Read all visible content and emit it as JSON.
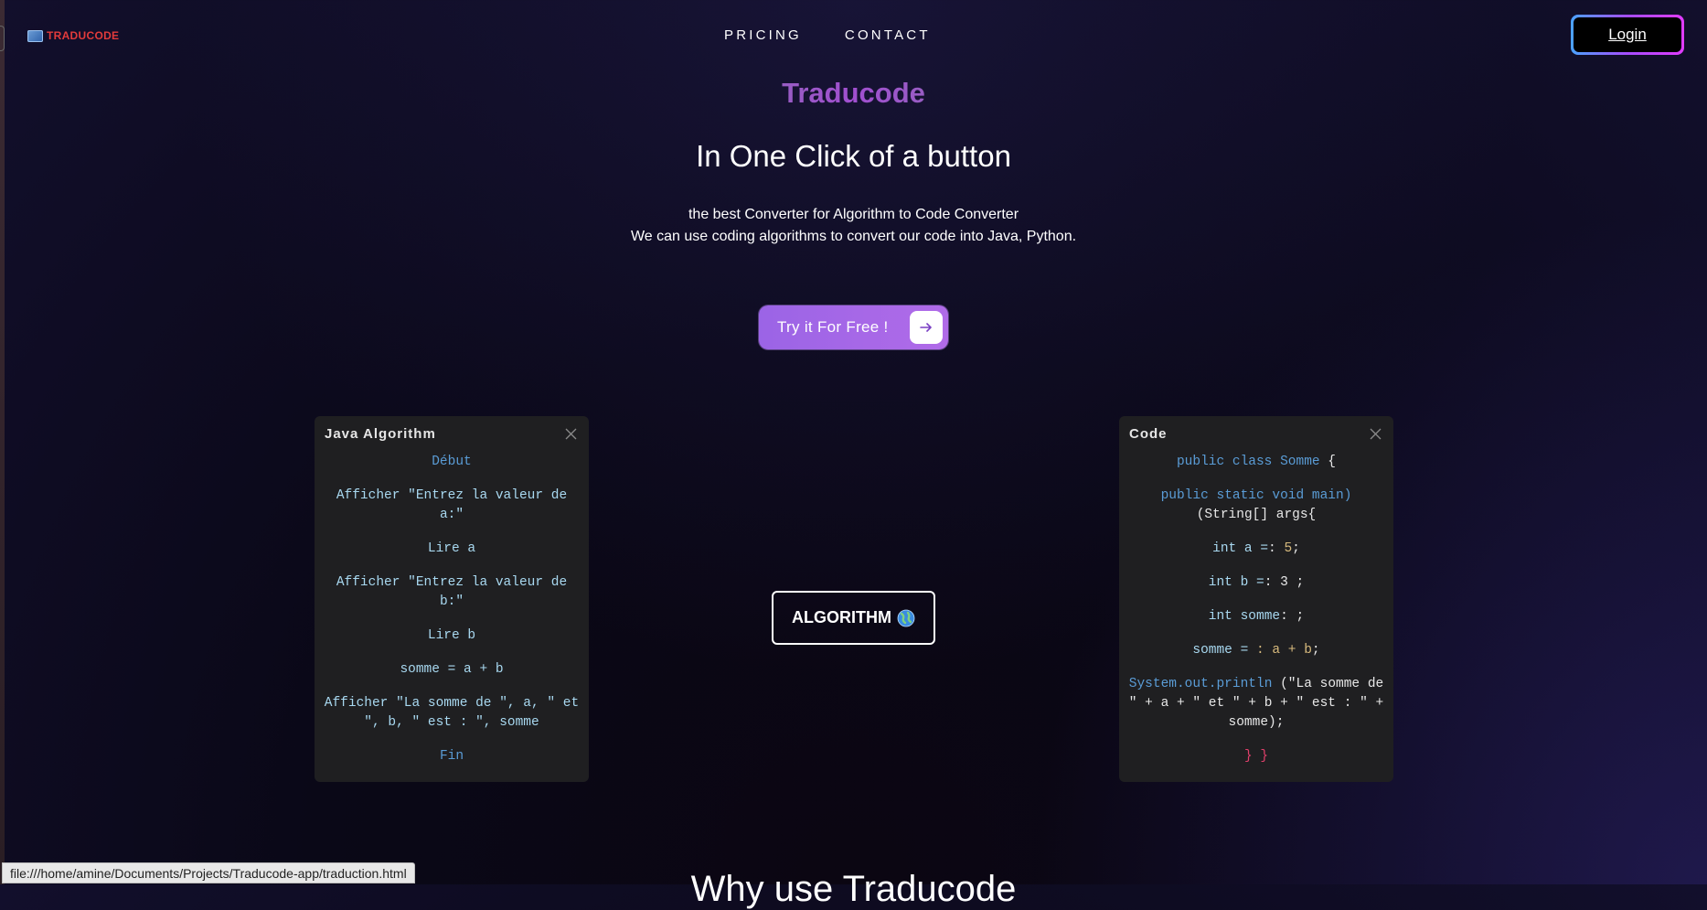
{
  "header": {
    "logo_text": "TRADUCODE",
    "nav": [
      "PRICING",
      "CONTACT"
    ],
    "login_label": "Login"
  },
  "hero": {
    "title": "Traducode",
    "subtitle": "In One Click of a button",
    "desc_line1": "the best Converter for Algorithm to Code Converter",
    "desc_line2": "We can use coding algorithms to convert our code into Java, Python.",
    "cta_label": "Try it For Free !"
  },
  "left_card": {
    "title": "Java Algorithm",
    "lines": [
      "Début",
      "Afficher \"Entrez la valeur de a:\"",
      "Lire a",
      "Afficher \"Entrez la valeur de b:\"",
      "Lire b",
      "somme = a + b",
      "Afficher \"La somme de \", a, \" et \", b, \" est : \", somme",
      "Fin"
    ]
  },
  "right_card": {
    "title": "Code",
    "line1_kw": "public class Somme",
    "line1_rest": " {",
    "line2_kw": "public static void main)",
    "line2_rest": "(String[] args{",
    "line3_a": "int a =",
    "line3_b": ": ",
    "line3_num": "5",
    "line3_c": ";",
    "line4_a": "int b =",
    "line4_b": ": 3 ;",
    "line5_a": "int somme",
    "line5_b": ": ;",
    "line6_a": "somme = ",
    "line6_b": ": a + b",
    "line6_c": ";",
    "line7_kw": "System.out.println",
    "line7_rest": " (\"La somme de \" + a + \" et \" + b + \" est : \" + somme);",
    "line8": "} }"
  },
  "center_button": {
    "label": "ALGORITHM",
    "icon": "globe-icon"
  },
  "bottom_heading": "Why use Traducode",
  "status_bar_url": "file:///home/amine/Documents/Projects/Traducode-app/traduction.html",
  "colors": {
    "accent_purple": "#a064e6",
    "keyword_blue": "#5a9cd6",
    "logo_red": "#e23b3b",
    "card_bg": "#1f1f21"
  }
}
